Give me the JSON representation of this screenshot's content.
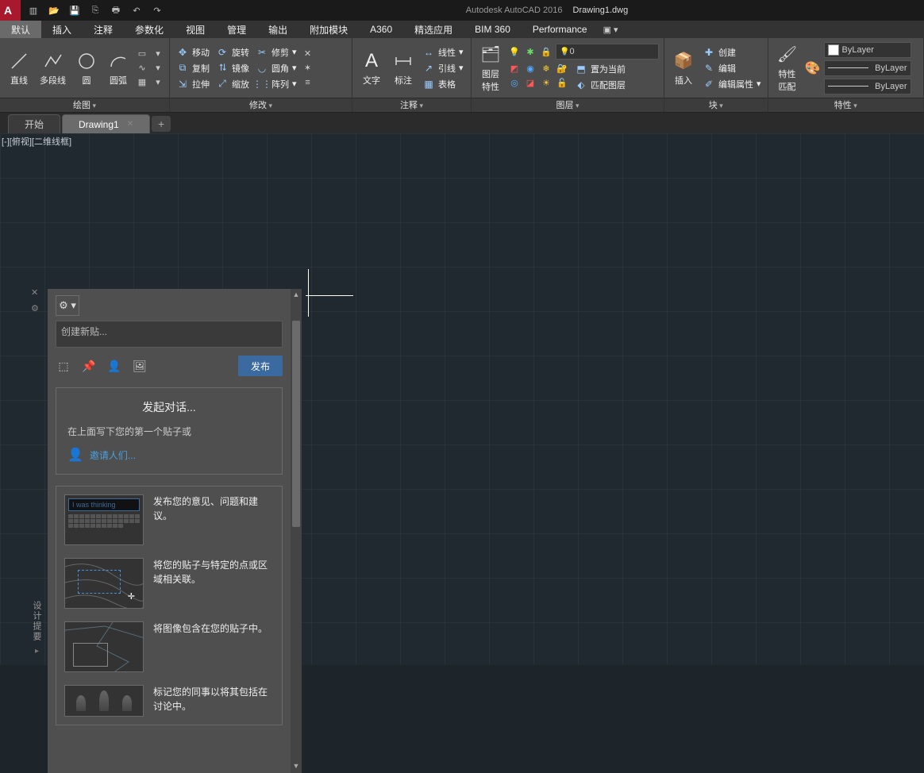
{
  "titlebar": {
    "app": "Autodesk AutoCAD 2016",
    "file": "Drawing1.dwg"
  },
  "menu": {
    "tabs": [
      "默认",
      "插入",
      "注释",
      "参数化",
      "视图",
      "管理",
      "输出",
      "附加模块",
      "A360",
      "精选应用",
      "BIM 360",
      "Performance"
    ],
    "extra": "▣ ▾"
  },
  "ribbon": {
    "draw": {
      "title": "绘图",
      "line": "直线",
      "polyline": "多段线",
      "circle": "圆",
      "arc": "圆弧"
    },
    "modify": {
      "title": "修改",
      "move": "移动",
      "rotate": "旋转",
      "trim": "修剪",
      "copy": "复制",
      "mirror": "镜像",
      "fillet": "圆角",
      "stretch": "拉伸",
      "scale": "缩放",
      "array": "阵列"
    },
    "annot": {
      "title": "注释",
      "text": "文字",
      "dim": "标注",
      "linear": "线性",
      "leader": "引线",
      "table": "表格"
    },
    "layer": {
      "title": "图层",
      "prop": "图层\n特性",
      "current": "0",
      "setcur": "置为当前",
      "match": "匹配图层"
    },
    "block": {
      "title": "块",
      "insert": "插入",
      "create": "创建",
      "edit": "编辑",
      "editattr": "编辑属性"
    },
    "props": {
      "title": "特性",
      "match": "特性\n匹配",
      "bylayer": "ByLayer"
    }
  },
  "filetabs": {
    "start": "开始",
    "drawing": "Drawing1"
  },
  "viewlabel": "[-][俯视][二维线框]",
  "palette": {
    "vtitle": "设计提要",
    "create_post": "创建新贴...",
    "publish": "发布",
    "start_title": "发起对话...",
    "start_sub": "在上面写下您的第一个贴子或",
    "invite": "邀请人们...",
    "tip1": "发布您的意见、问题和建议。",
    "tip1_thumb": "I was thinking",
    "tip2": "将您的贴子与特定的点或区域相关联。",
    "tip3": "将图像包含在您的贴子中。",
    "tip4": "标记您的同事以将其包括在讨论中。"
  }
}
